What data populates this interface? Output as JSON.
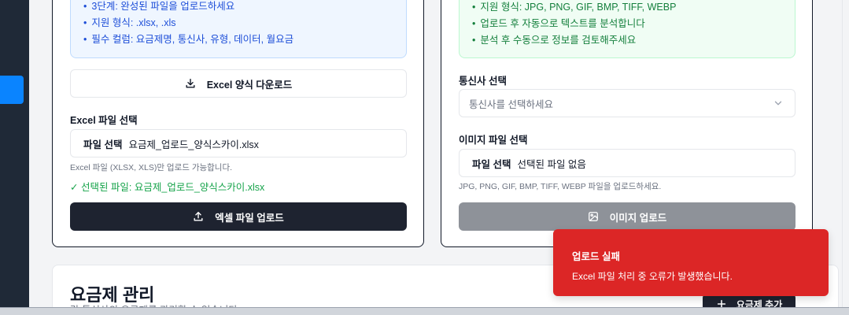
{
  "excel_card": {
    "info_items": [
      "3단계: 완성된 파일을 업로드하세요",
      "지원 형식: .xlsx, .xls",
      "필수 컬럼: 요금제명, 통신사, 유형, 데이터, 월요금"
    ],
    "download_label": "Excel 양식 다운로드",
    "file_label": "Excel 파일 선택",
    "file_choose": "파일 선택",
    "file_name": "요금제_업로드_양식스카이.xlsx",
    "help": "Excel 파일 (XLSX, XLS)만 업로드 가능합니다.",
    "selected": "✓ 선택된 파일: 요금제_업로드_양식스카이.xlsx",
    "upload_label": "엑셀 파일 업로드"
  },
  "image_card": {
    "info_items": [
      "지원 형식: JPG, PNG, GIF, BMP, TIFF, WEBP",
      "업로드 후 자동으로 텍스트를 분석합니다",
      "분석 후 수동으로 정보를 검토해주세요"
    ],
    "carrier_label": "통신사 선택",
    "carrier_placeholder": "통신사를 선택하세요",
    "file_label": "이미지 파일 선택",
    "file_choose": "파일 선택",
    "file_name": "선택된 파일 없음",
    "help": "JPG, PNG, GIF, BMP, TIFF, WEBP 파일을 업로드하세요.",
    "upload_label": "이미지 업로드"
  },
  "plan_card": {
    "title": "요금제 관리",
    "subtitle": "각 통신사의 요금제를 관리할 수 있습니다.",
    "add_label": "요금제 추가"
  },
  "toast": {
    "title": "업로드 실패",
    "description": "Excel 파일 처리 중 오류가 발생했습니다."
  },
  "colors": {
    "primary_dark": "#1e2330",
    "error": "#dc2626",
    "success": "#16a34a",
    "accent": "#0a84ff"
  }
}
